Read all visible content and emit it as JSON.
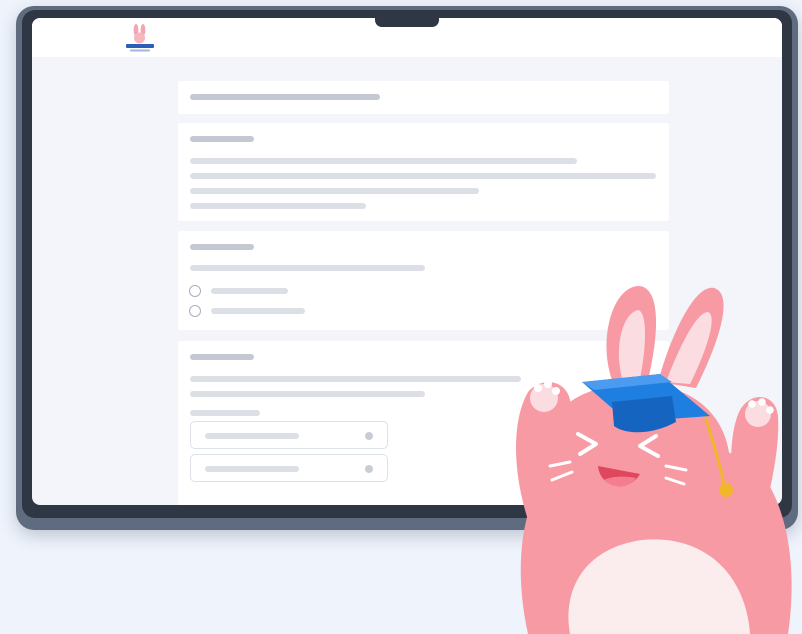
{
  "brand": {
    "logo_icon": "bunny-logo-icon"
  },
  "mascot": {
    "icon": "bunny-graduation-cap-mascot"
  },
  "colors": {
    "background": "#eef3fc",
    "laptop_frame": "#5f6b7e",
    "bezel": "#2f3644",
    "screen": "#f3f5fb",
    "card": "#ffffff",
    "placeholder_line": "#dcdfe6",
    "bunny_pink": "#f79aa4",
    "bunny_belly": "#fbecee",
    "cap_blue": "#1e7fe0",
    "tassel_gold": "#f2b62b"
  }
}
